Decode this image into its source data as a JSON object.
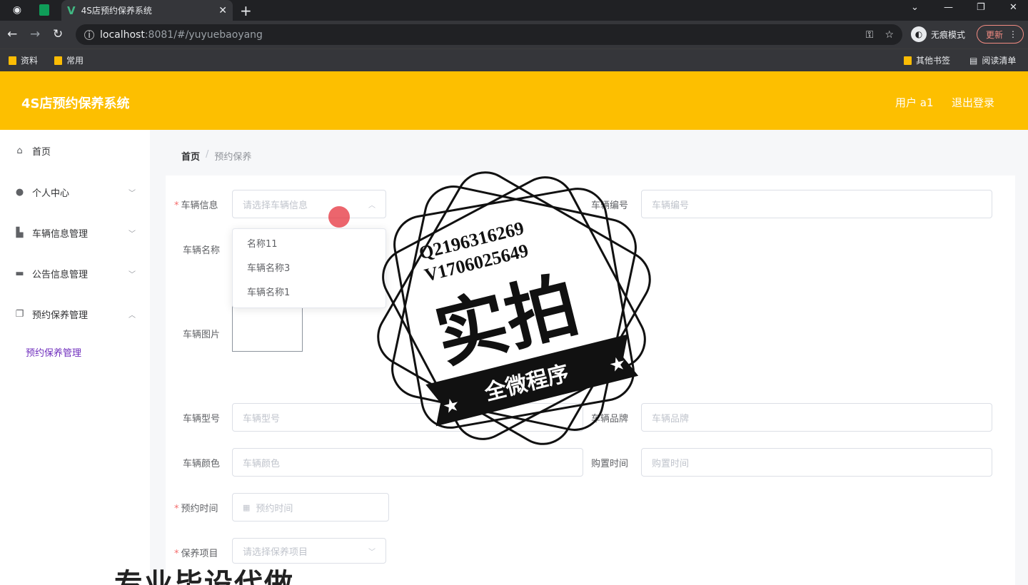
{
  "browser": {
    "tab_title": "4S店预约保养系统",
    "url_host": "localhost",
    "url_path": ":8081/#/yuyuebaoyang",
    "incognito_label": "无痕模式",
    "update_label": "更新",
    "bookmarks": [
      "资料",
      "常用"
    ],
    "other_bookmarks": "其他书签",
    "reading_list": "阅读清单"
  },
  "header": {
    "title": "4S店预约保养系统",
    "user": "用户 a1",
    "logout": "退出登录"
  },
  "sidebar": {
    "items": [
      {
        "label": "首页",
        "icon": "home-icon"
      },
      {
        "label": "个人中心",
        "icon": "user-icon"
      },
      {
        "label": "车辆信息管理",
        "icon": "car-icon"
      },
      {
        "label": "公告信息管理",
        "icon": "monitor-icon"
      },
      {
        "label": "预约保养管理",
        "icon": "copy-icon"
      }
    ],
    "submenu": "预约保养管理"
  },
  "breadcrumb": {
    "home": "首页",
    "separator": "/",
    "current": "预约保养"
  },
  "form": {
    "vehicle_info_label": "车辆信息",
    "vehicle_info_placeholder": "请选择车辆信息",
    "vehicle_no_label": "车辆编号",
    "vehicle_no_placeholder": "车辆编号",
    "vehicle_name_label": "车辆名称",
    "vehicle_image_label": "车辆图片",
    "vehicle_model_label": "车辆型号",
    "vehicle_model_placeholder": "车辆型号",
    "vehicle_brand_label": "车辆品牌",
    "vehicle_brand_placeholder": "车辆品牌",
    "vehicle_color_label": "车辆颜色",
    "vehicle_color_placeholder": "车辆颜色",
    "purchase_time_label": "购置时间",
    "purchase_time_placeholder": "购置时间",
    "booking_time_label": "预约时间",
    "booking_time_placeholder": "预约时间",
    "maintenance_item_label": "保养项目",
    "maintenance_item_placeholder": "请选择保养项目"
  },
  "dropdown_options": [
    "名称11",
    "车辆名称3",
    "车辆名称1"
  ],
  "watermark": {
    "line1": "Q2196316269",
    "line2": "V1706025649",
    "main": "实拍",
    "ribbon": "全微程序"
  },
  "bottom_banner": "专业毕设代做"
}
